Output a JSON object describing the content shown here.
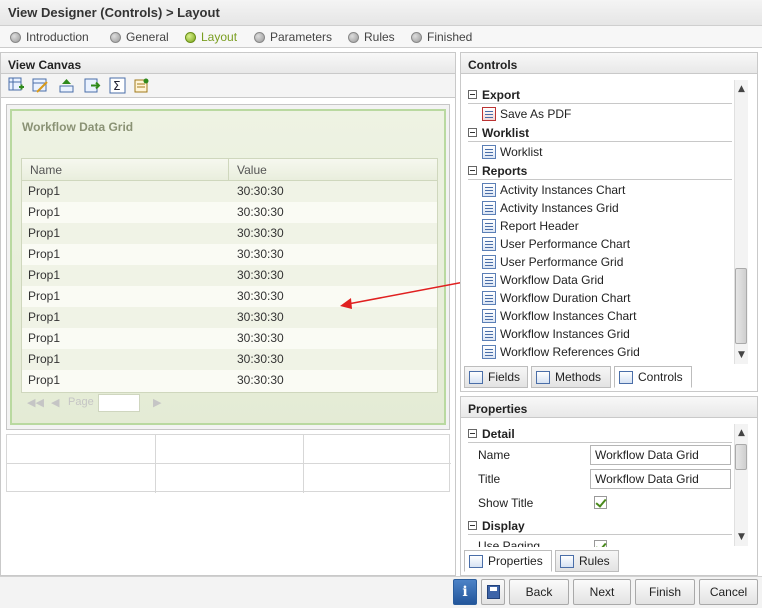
{
  "window": {
    "title": "View Designer (Controls) > Layout"
  },
  "steps": [
    {
      "label": "Introduction",
      "active": false
    },
    {
      "label": "General",
      "active": false
    },
    {
      "label": "Layout",
      "active": true
    },
    {
      "label": "Parameters",
      "active": false
    },
    {
      "label": "Rules",
      "active": false
    },
    {
      "label": "Finished",
      "active": false
    }
  ],
  "view_canvas": {
    "title": "View Canvas",
    "toolbar_icons": [
      "add-control-icon",
      "edit-table-icon",
      "move-up-icon",
      "export-icon",
      "sum-icon",
      "properties-icon"
    ],
    "grid_control": {
      "title": "Workflow Data Grid",
      "columns": [
        "Name",
        "Value"
      ],
      "rows": [
        [
          "Prop1",
          "30:30:30"
        ],
        [
          "Prop1",
          "30:30:30"
        ],
        [
          "Prop1",
          "30:30:30"
        ],
        [
          "Prop1",
          "30:30:30"
        ],
        [
          "Prop1",
          "30:30:30"
        ],
        [
          "Prop1",
          "30:30:30"
        ],
        [
          "Prop1",
          "30:30:30"
        ],
        [
          "Prop1",
          "30:30:30"
        ],
        [
          "Prop1",
          "30:30:30"
        ],
        [
          "Prop1",
          "30:30:30"
        ]
      ],
      "pager": {
        "page_label": "Page",
        "page_value": ""
      }
    }
  },
  "controls": {
    "title": "Controls",
    "sections": [
      {
        "name": "Export",
        "items": [
          "Save As PDF"
        ]
      },
      {
        "name": "Worklist",
        "items": [
          "Worklist"
        ]
      },
      {
        "name": "Reports",
        "items": [
          "Activity Instances Chart",
          "Activity Instances Grid",
          "Report Header",
          "User Performance Chart",
          "User Performance Grid",
          "Workflow Data Grid",
          "Workflow Duration Chart",
          "Workflow Instances Chart",
          "Workflow Instances Grid",
          "Workflow References Grid"
        ]
      }
    ],
    "tabs": [
      "Fields",
      "Methods",
      "Controls"
    ]
  },
  "properties": {
    "title": "Properties",
    "sections": {
      "detail": "Detail",
      "display": "Display"
    },
    "fields": {
      "name_label": "Name",
      "name_value": "Workflow Data Grid",
      "title_label": "Title",
      "title_value": "Workflow Data Grid",
      "show_title_label": "Show Title",
      "show_title_checked": true,
      "use_paging_label": "Use Paging"
    },
    "tabs": [
      "Properties",
      "Rules"
    ]
  },
  "footer": {
    "info_label": "i",
    "back": "Back",
    "next": "Next",
    "finish": "Finish",
    "cancel": "Cancel"
  },
  "colors": {
    "accent_green": "#7a9e21",
    "arrow_red": "#e02020"
  }
}
